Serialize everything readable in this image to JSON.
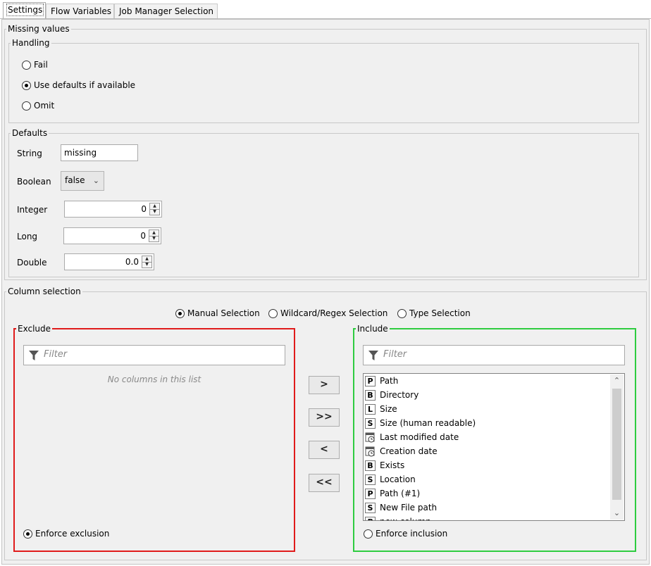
{
  "tabs": [
    {
      "label": "Settings",
      "active": true
    },
    {
      "label": "Flow Variables",
      "active": false
    },
    {
      "label": "Job Manager Selection",
      "active": false
    }
  ],
  "missing_values": {
    "legend": "Missing values",
    "handling": {
      "legend": "Handling",
      "options": [
        {
          "label": "Fail",
          "selected": false
        },
        {
          "label": "Use defaults if available",
          "selected": true
        },
        {
          "label": "Omit",
          "selected": false
        }
      ]
    },
    "defaults": {
      "legend": "Defaults",
      "string_label": "String",
      "string_value": "missing",
      "boolean_label": "Boolean",
      "boolean_value": "false",
      "integer_label": "Integer",
      "integer_value": "0",
      "long_label": "Long",
      "long_value": "0",
      "double_label": "Double",
      "double_value": "0.0"
    }
  },
  "column_selection": {
    "legend": "Column selection",
    "modes": [
      {
        "label": "Manual Selection",
        "selected": true
      },
      {
        "label": "Wildcard/Regex Selection",
        "selected": false
      },
      {
        "label": "Type Selection",
        "selected": false
      }
    ],
    "exclude": {
      "legend": "Exclude",
      "filter_placeholder": "Filter",
      "empty_text": "No columns in this list",
      "enforce_label": "Enforce exclusion",
      "enforce_selected": true,
      "border_color": "#e01b1b"
    },
    "include": {
      "legend": "Include",
      "filter_placeholder": "Filter",
      "enforce_label": "Enforce inclusion",
      "enforce_selected": false,
      "border_color": "#2ecc40",
      "columns": [
        {
          "type": "P",
          "name": "Path"
        },
        {
          "type": "B",
          "name": "Directory"
        },
        {
          "type": "L",
          "name": "Size"
        },
        {
          "type": "S",
          "name": "Size (human readable)"
        },
        {
          "type": "date-time",
          "name": "Last modified date"
        },
        {
          "type": "date-time",
          "name": "Creation date"
        },
        {
          "type": "B",
          "name": "Exists"
        },
        {
          "type": "S",
          "name": "Location"
        },
        {
          "type": "P",
          "name": "Path (#1)"
        },
        {
          "type": "S",
          "name": "New File path"
        },
        {
          "type": "P",
          "name": "new column"
        }
      ]
    },
    "buttons": {
      "add": ">",
      "add_all": ">>",
      "remove": "<",
      "remove_all": "<<"
    }
  }
}
